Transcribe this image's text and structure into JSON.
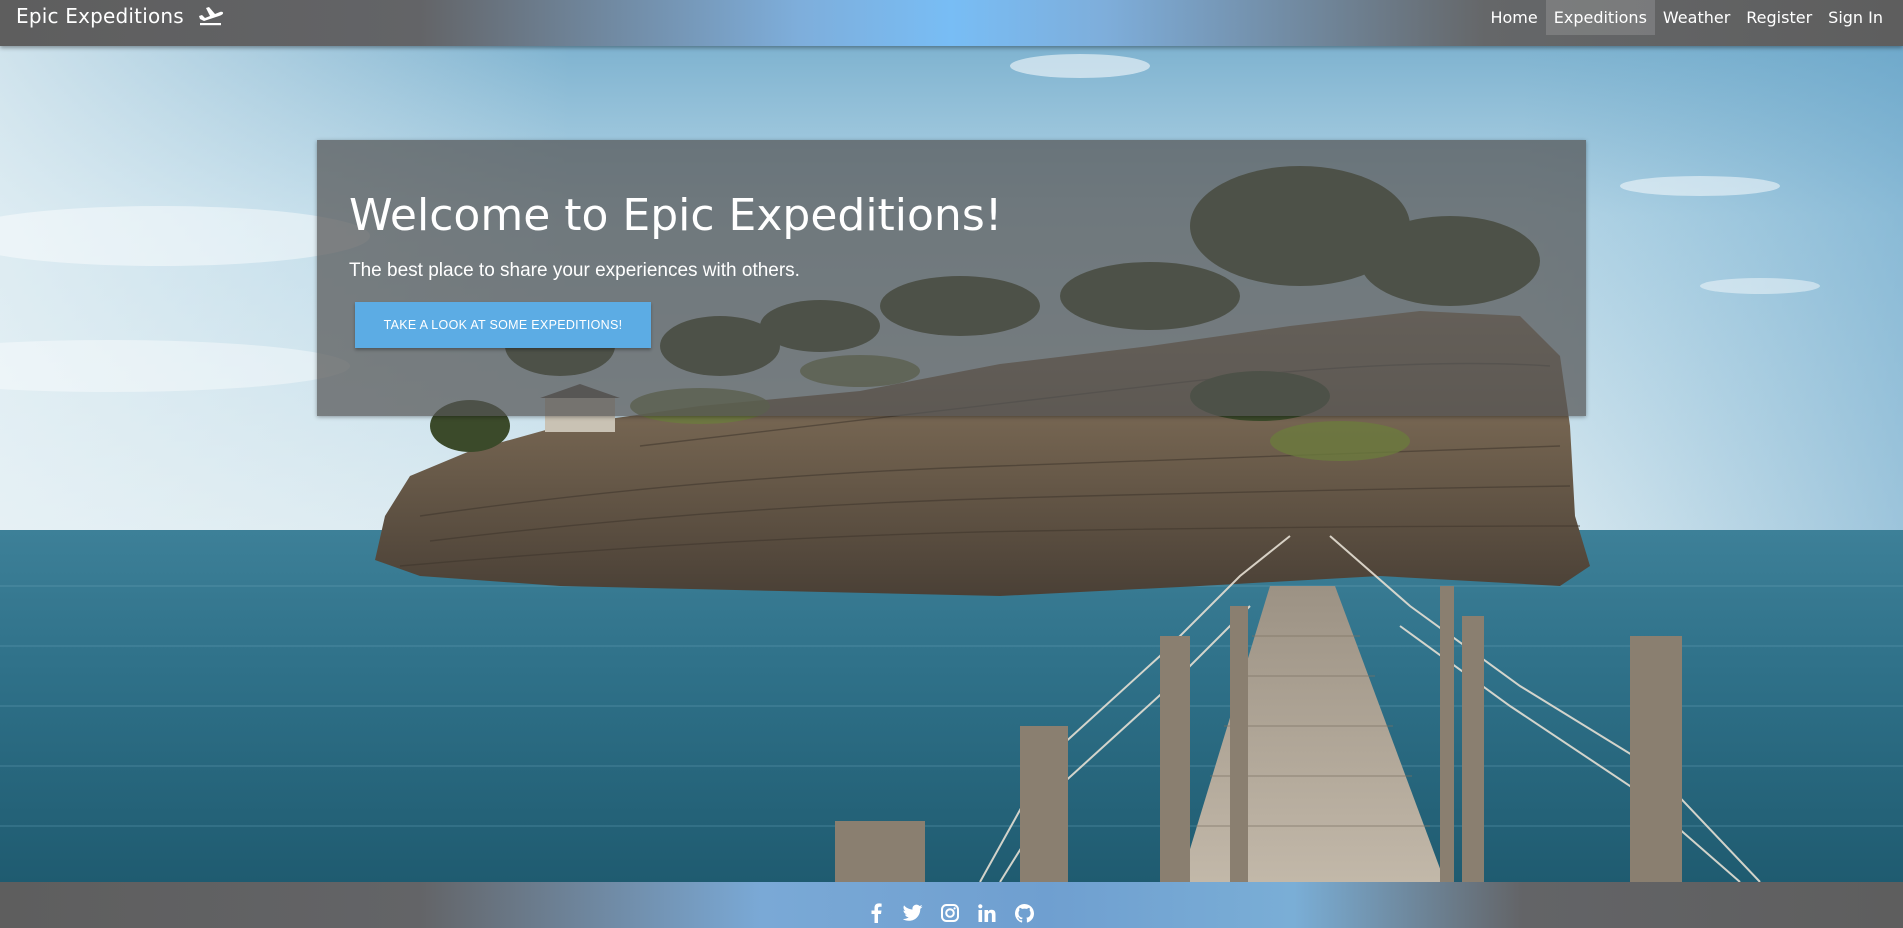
{
  "navbar": {
    "brand": "Epic Expeditions",
    "brand_icon": "plane-departure-icon",
    "links": [
      {
        "label": "Home",
        "active": false
      },
      {
        "label": "Expeditions",
        "active": true
      },
      {
        "label": "Weather",
        "active": false
      },
      {
        "label": "Register",
        "active": false
      },
      {
        "label": "Sign In",
        "active": false
      }
    ]
  },
  "hero": {
    "title": "Welcome to Epic Expeditions!",
    "subtitle": "The best place to share your experiences with others.",
    "cta_label": "TAKE A LOOK AT SOME EXPEDITIONS!"
  },
  "footer": {
    "socials": [
      "facebook-icon",
      "twitter-icon",
      "instagram-icon",
      "linkedin-icon",
      "github-icon"
    ]
  },
  "colors": {
    "button": "#5cace4",
    "nav_accent": "#78bdf5",
    "sea": "#2e7188",
    "sky": "#9fcbe3"
  }
}
